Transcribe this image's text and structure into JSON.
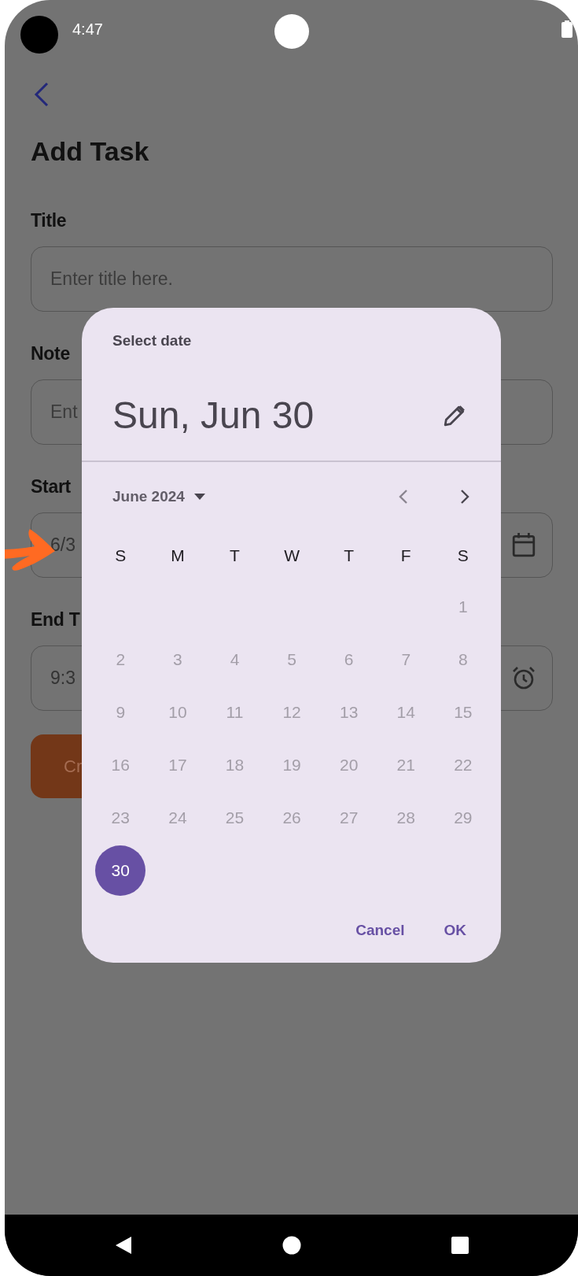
{
  "status_bar": {
    "time": "4:47"
  },
  "page": {
    "title": "Add Task",
    "fields": [
      {
        "label": "Title",
        "placeholder": "Enter title here.",
        "kind": "text"
      },
      {
        "label": "Note",
        "placeholder": "Ent",
        "kind": "text"
      },
      {
        "label": "Start",
        "value": "6/3",
        "kind": "date"
      },
      {
        "label": "End T",
        "value": "9:3",
        "kind": "time"
      }
    ],
    "button": "Cr"
  },
  "date_picker": {
    "title": "Select date",
    "headline": "Sun, Jun 30",
    "month": "June 2024",
    "weekdays": [
      "S",
      "M",
      "T",
      "W",
      "T",
      "F",
      "S"
    ],
    "weeks": [
      [
        {
          "day": "1",
          "disabled": true,
          "selected": false
        }
      ],
      [
        {
          "day": "2",
          "disabled": true,
          "selected": false
        },
        {
          "day": "3",
          "disabled": true,
          "selected": false
        },
        {
          "day": "4",
          "disabled": true,
          "selected": false
        },
        {
          "day": "5",
          "disabled": true,
          "selected": false
        },
        {
          "day": "6",
          "disabled": true,
          "selected": false
        },
        {
          "day": "7",
          "disabled": true,
          "selected": false
        },
        {
          "day": "8",
          "disabled": true,
          "selected": false
        }
      ],
      [
        {
          "day": "9",
          "disabled": true,
          "selected": false
        },
        {
          "day": "10",
          "disabled": true,
          "selected": false
        },
        {
          "day": "11",
          "disabled": true,
          "selected": false
        },
        {
          "day": "12",
          "disabled": true,
          "selected": false
        },
        {
          "day": "13",
          "disabled": true,
          "selected": false
        },
        {
          "day": "14",
          "disabled": true,
          "selected": false
        },
        {
          "day": "15",
          "disabled": true,
          "selected": false
        }
      ],
      [
        {
          "day": "16",
          "disabled": true,
          "selected": false
        },
        {
          "day": "17",
          "disabled": true,
          "selected": false
        },
        {
          "day": "18",
          "disabled": true,
          "selected": false
        },
        {
          "day": "19",
          "disabled": true,
          "selected": false
        },
        {
          "day": "20",
          "disabled": true,
          "selected": false
        },
        {
          "day": "21",
          "disabled": true,
          "selected": false
        },
        {
          "day": "22",
          "disabled": true,
          "selected": false
        }
      ],
      [
        {
          "day": "23",
          "disabled": true,
          "selected": false
        },
        {
          "day": "24",
          "disabled": true,
          "selected": false
        },
        {
          "day": "25",
          "disabled": true,
          "selected": false
        },
        {
          "day": "26",
          "disabled": true,
          "selected": false
        },
        {
          "day": "27",
          "disabled": true,
          "selected": false
        },
        {
          "day": "28",
          "disabled": true,
          "selected": false
        },
        {
          "day": "29",
          "disabled": true,
          "selected": false
        }
      ],
      [
        {
          "day": "30",
          "disabled": false,
          "selected": true
        }
      ]
    ],
    "actions": [
      "Cancel",
      "OK"
    ]
  }
}
